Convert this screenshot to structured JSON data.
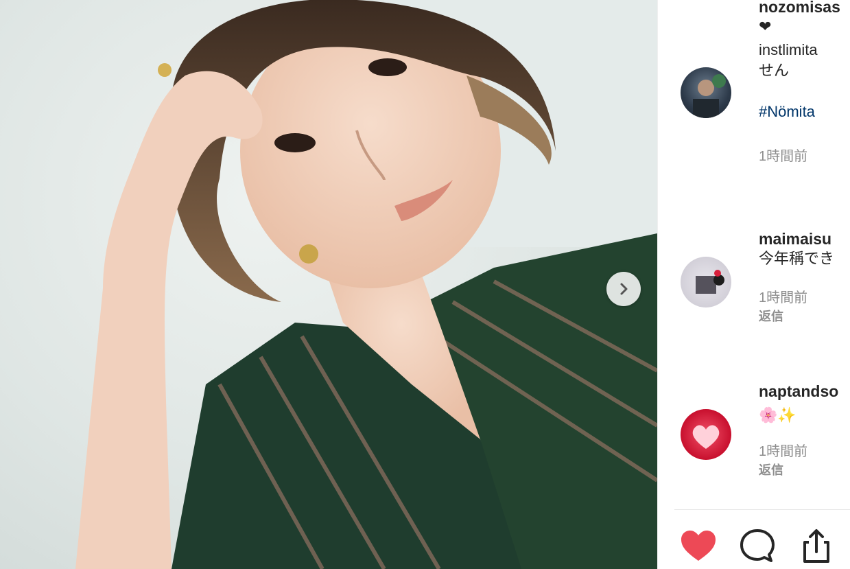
{
  "post": {
    "image_alt_icon": "photo",
    "next_icon": "chevron-right-icon"
  },
  "comments": [
    {
      "username": "nozomisas",
      "line1": "❤",
      "line2": "instlimita",
      "line3": "せん",
      "hashtag": "#Nömita",
      "time": "1時間前"
    },
    {
      "username": "maimaisu",
      "text": "今年稱でき",
      "time": "1時間前",
      "reply": "返信"
    },
    {
      "username": "naptandso",
      "text": "🌸✨",
      "time": "1時間前",
      "reply": "返信"
    }
  ],
  "actions": {
    "like_icon": "heart-icon",
    "comment_icon": "comment-icon",
    "share_icon": "share-icon",
    "like_color": "#ed4956"
  }
}
